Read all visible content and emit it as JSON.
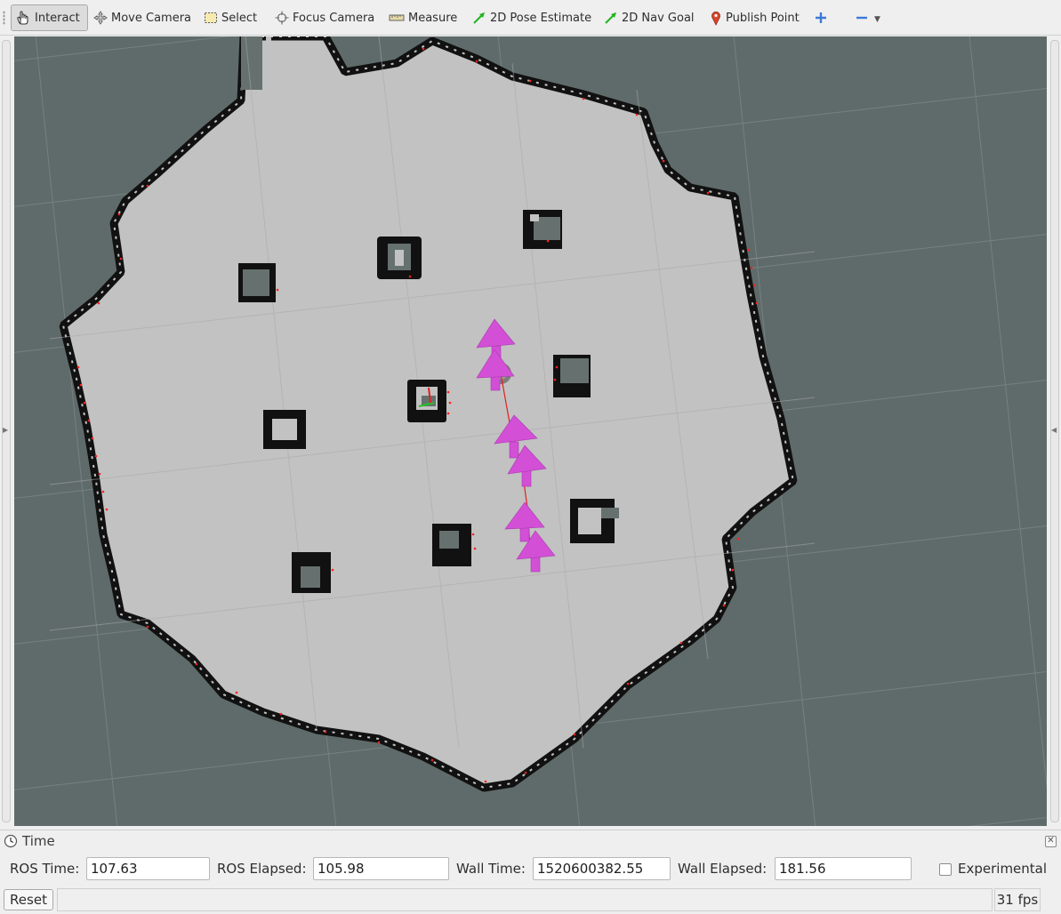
{
  "toolbar": {
    "tools": [
      {
        "label": "Interact",
        "icon": "hand-icon",
        "active": true
      },
      {
        "label": "Move Camera",
        "icon": "move-camera-icon"
      },
      {
        "label": "Select",
        "icon": "select-box-icon"
      },
      {
        "label": "Focus Camera",
        "icon": "crosshair-icon"
      },
      {
        "label": "Measure",
        "icon": "ruler-icon"
      },
      {
        "label": "2D Pose Estimate",
        "icon": "green-arrow-icon"
      },
      {
        "label": "2D Nav Goal",
        "icon": "green-arrow-icon"
      },
      {
        "label": "Publish Point",
        "icon": "map-pin-icon"
      }
    ],
    "add_icon": "plus-icon",
    "remove_icon": "minus-icon"
  },
  "colors": {
    "viewport_bg": "#5f6b6a",
    "free_space": "#c2c2c2",
    "occupied": "#111111",
    "unknown_cell": "#66716f",
    "pose_arrow": "#d24fd6",
    "laser_point": "#ff2020"
  },
  "time_panel": {
    "title": "Time",
    "ros_time_label": "ROS Time:",
    "ros_time_value": "107.63",
    "ros_elapsed_label": "ROS Elapsed:",
    "ros_elapsed_value": "105.98",
    "wall_time_label": "Wall Time:",
    "wall_time_value": "1520600382.55",
    "wall_elapsed_label": "Wall Elapsed:",
    "wall_elapsed_value": "181.56",
    "experimental_label": "Experimental",
    "experimental_checked": false
  },
  "status_bar": {
    "reset_label": "Reset",
    "fps": "31 fps"
  }
}
